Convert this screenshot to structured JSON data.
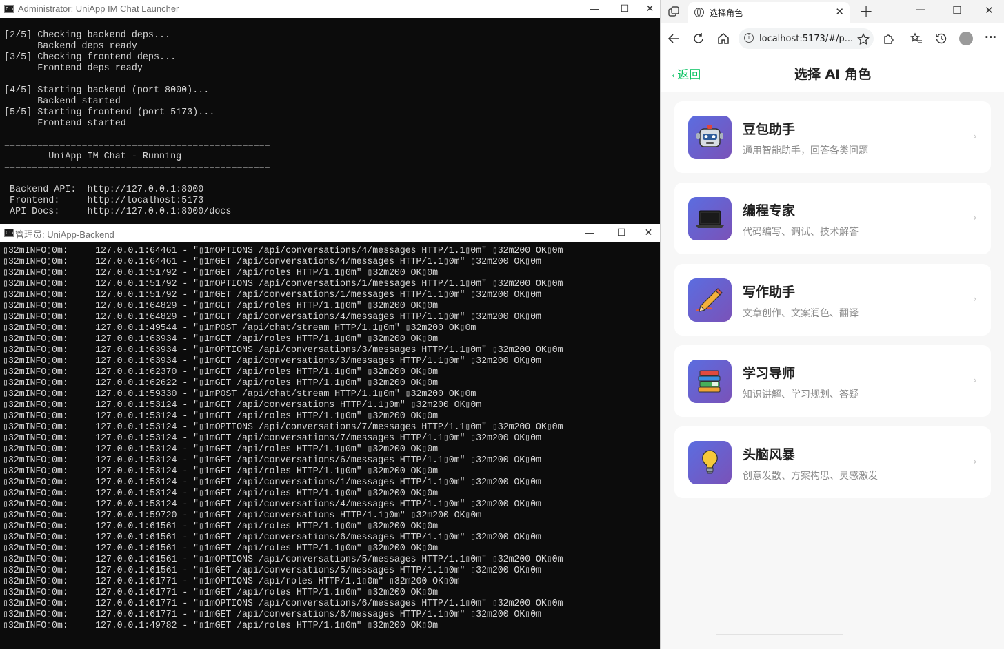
{
  "launcher": {
    "title": "Administrator:  UniApp IM Chat Launcher",
    "controls": {
      "minimize": "—",
      "maximize": "☐",
      "close": "✕"
    },
    "lines": [
      "[2/5] Checking backend deps...",
      "      Backend deps ready",
      "[3/5] Checking frontend deps...",
      "      Frontend deps ready",
      "",
      "[4/5] Starting backend (port 8000)...",
      "      Backend started",
      "[5/5] Starting frontend (port 5173)...",
      "      Frontend started",
      "",
      "================================================",
      "        UniApp IM Chat - Running",
      "================================================",
      "",
      " Backend API:  http://127.0.0.1:8000",
      " Frontend:     http://localhost:5173",
      " API Docs:     http://127.0.0.1:8000/docs"
    ]
  },
  "backend": {
    "title": "管理员:  UniApp-Backend",
    "controls": {
      "minimize": "—",
      "maximize": "☐",
      "close": "✕"
    },
    "log": [
      "▯32mINFO▯0m:     127.0.0.1:64461 - \"▯1mOPTIONS /api/conversations/4/messages HTTP/1.1▯0m\" ▯32m200 OK▯0m",
      "▯32mINFO▯0m:     127.0.0.1:64461 - \"▯1mGET /api/conversations/4/messages HTTP/1.1▯0m\" ▯32m200 OK▯0m",
      "▯32mINFO▯0m:     127.0.0.1:51792 - \"▯1mGET /api/roles HTTP/1.1▯0m\" ▯32m200 OK▯0m",
      "▯32mINFO▯0m:     127.0.0.1:51792 - \"▯1mOPTIONS /api/conversations/1/messages HTTP/1.1▯0m\" ▯32m200 OK▯0m",
      "▯32mINFO▯0m:     127.0.0.1:51792 - \"▯1mGET /api/conversations/1/messages HTTP/1.1▯0m\" ▯32m200 OK▯0m",
      "▯32mINFO▯0m:     127.0.0.1:64829 - \"▯1mGET /api/roles HTTP/1.1▯0m\" ▯32m200 OK▯0m",
      "▯32mINFO▯0m:     127.0.0.1:64829 - \"▯1mGET /api/conversations/4/messages HTTP/1.1▯0m\" ▯32m200 OK▯0m",
      "▯32mINFO▯0m:     127.0.0.1:49544 - \"▯1mPOST /api/chat/stream HTTP/1.1▯0m\" ▯32m200 OK▯0m",
      "▯32mINFO▯0m:     127.0.0.1:63934 - \"▯1mGET /api/roles HTTP/1.1▯0m\" ▯32m200 OK▯0m",
      "▯32mINFO▯0m:     127.0.0.1:63934 - \"▯1mOPTIONS /api/conversations/3/messages HTTP/1.1▯0m\" ▯32m200 OK▯0m",
      "▯32mINFO▯0m:     127.0.0.1:63934 - \"▯1mGET /api/conversations/3/messages HTTP/1.1▯0m\" ▯32m200 OK▯0m",
      "▯32mINFO▯0m:     127.0.0.1:62370 - \"▯1mGET /api/roles HTTP/1.1▯0m\" ▯32m200 OK▯0m",
      "▯32mINFO▯0m:     127.0.0.1:62622 - \"▯1mGET /api/roles HTTP/1.1▯0m\" ▯32m200 OK▯0m",
      "▯32mINFO▯0m:     127.0.0.1:59330 - \"▯1mPOST /api/chat/stream HTTP/1.1▯0m\" ▯32m200 OK▯0m",
      "▯32mINFO▯0m:     127.0.0.1:53124 - \"▯1mGET /api/conversations HTTP/1.1▯0m\" ▯32m200 OK▯0m",
      "▯32mINFO▯0m:     127.0.0.1:53124 - \"▯1mGET /api/roles HTTP/1.1▯0m\" ▯32m200 OK▯0m",
      "▯32mINFO▯0m:     127.0.0.1:53124 - \"▯1mOPTIONS /api/conversations/7/messages HTTP/1.1▯0m\" ▯32m200 OK▯0m",
      "▯32mINFO▯0m:     127.0.0.1:53124 - \"▯1mGET /api/conversations/7/messages HTTP/1.1▯0m\" ▯32m200 OK▯0m",
      "▯32mINFO▯0m:     127.0.0.1:53124 - \"▯1mGET /api/roles HTTP/1.1▯0m\" ▯32m200 OK▯0m",
      "▯32mINFO▯0m:     127.0.0.1:53124 - \"▯1mGET /api/conversations/6/messages HTTP/1.1▯0m\" ▯32m200 OK▯0m",
      "▯32mINFO▯0m:     127.0.0.1:53124 - \"▯1mGET /api/roles HTTP/1.1▯0m\" ▯32m200 OK▯0m",
      "▯32mINFO▯0m:     127.0.0.1:53124 - \"▯1mGET /api/conversations/1/messages HTTP/1.1▯0m\" ▯32m200 OK▯0m",
      "▯32mINFO▯0m:     127.0.0.1:53124 - \"▯1mGET /api/roles HTTP/1.1▯0m\" ▯32m200 OK▯0m",
      "▯32mINFO▯0m:     127.0.0.1:53124 - \"▯1mGET /api/conversations/4/messages HTTP/1.1▯0m\" ▯32m200 OK▯0m",
      "▯32mINFO▯0m:     127.0.0.1:59720 - \"▯1mGET /api/conversations HTTP/1.1▯0m\" ▯32m200 OK▯0m",
      "▯32mINFO▯0m:     127.0.0.1:61561 - \"▯1mGET /api/roles HTTP/1.1▯0m\" ▯32m200 OK▯0m",
      "▯32mINFO▯0m:     127.0.0.1:61561 - \"▯1mGET /api/conversations/6/messages HTTP/1.1▯0m\" ▯32m200 OK▯0m",
      "▯32mINFO▯0m:     127.0.0.1:61561 - \"▯1mGET /api/roles HTTP/1.1▯0m\" ▯32m200 OK▯0m",
      "▯32mINFO▯0m:     127.0.0.1:61561 - \"▯1mOPTIONS /api/conversations/5/messages HTTP/1.1▯0m\" ▯32m200 OK▯0m",
      "▯32mINFO▯0m:     127.0.0.1:61561 - \"▯1mGET /api/conversations/5/messages HTTP/1.1▯0m\" ▯32m200 OK▯0m",
      "▯32mINFO▯0m:     127.0.0.1:61771 - \"▯1mOPTIONS /api/roles HTTP/1.1▯0m\" ▯32m200 OK▯0m",
      "▯32mINFO▯0m:     127.0.0.1:61771 - \"▯1mGET /api/roles HTTP/1.1▯0m\" ▯32m200 OK▯0m",
      "▯32mINFO▯0m:     127.0.0.1:61771 - \"▯1mOPTIONS /api/conversations/6/messages HTTP/1.1▯0m\" ▯32m200 OK▯0m",
      "▯32mINFO▯0m:     127.0.0.1:61771 - \"▯1mGET /api/conversations/6/messages HTTP/1.1▯0m\" ▯32m200 OK▯0m",
      "▯32mINFO▯0m:     127.0.0.1:49782 - \"▯1mGET /api/roles HTTP/1.1▯0m\" ▯32m200 OK▯0m"
    ]
  },
  "browser": {
    "tab_title": "选择角色",
    "url": "localhost:5173/#/p...",
    "icons": [
      "tab-actions-icon",
      "globe-icon",
      "close-icon",
      "new-tab-icon",
      "back-icon",
      "refresh-icon",
      "home-icon",
      "info-icon",
      "favorite-star-icon",
      "extensions-icon",
      "favorites-icon",
      "history-icon",
      "profile-avatar",
      "more-icon"
    ],
    "controls": {
      "minimize": "—",
      "maximize": "☐",
      "close": "✕",
      "new_tab": "+",
      "more": "···"
    }
  },
  "app": {
    "back_label": "返回",
    "title": "选择 AI 角色",
    "accent_color": "#07c160",
    "roles": [
      {
        "name": "豆包助手",
        "desc": "通用智能助手，回答各类问题",
        "icon": "robot-icon"
      },
      {
        "name": "编程专家",
        "desc": "代码编写、调试、技术解答",
        "icon": "laptop-icon"
      },
      {
        "name": "写作助手",
        "desc": "文章创作、文案润色、翻译",
        "icon": "pencil-icon"
      },
      {
        "name": "学习导师",
        "desc": "知识讲解、学习规划、答疑",
        "icon": "books-icon"
      },
      {
        "name": "头脑风暴",
        "desc": "创意发散、方案构思、灵感激发",
        "icon": "lightbulb-icon"
      }
    ]
  }
}
